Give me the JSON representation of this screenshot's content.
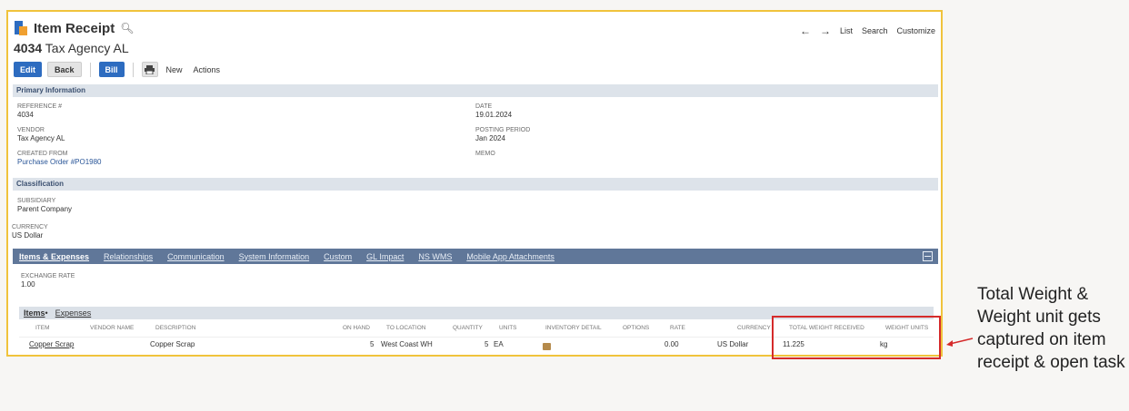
{
  "header": {
    "record_type": "Item Receipt",
    "record_number": "4034",
    "record_name": "Tax Agency AL",
    "nav": {
      "prev": "←",
      "next": "→",
      "list": "List",
      "search": "Search",
      "customize": "Customize"
    }
  },
  "buttons": {
    "edit": "Edit",
    "back": "Back",
    "bill": "Bill",
    "new": "New",
    "actions": "Actions"
  },
  "primary": {
    "title": "Primary Information",
    "reference_label": "REFERENCE #",
    "reference_value": "4034",
    "vendor_label": "VENDOR",
    "vendor_value": "Tax Agency AL",
    "created_from_label": "CREATED FROM",
    "created_from_value": "Purchase Order #PO1980",
    "date_label": "DATE",
    "date_value": "19.01.2024",
    "posting_period_label": "POSTING PERIOD",
    "posting_period_value": "Jan 2024",
    "memo_label": "MEMO"
  },
  "classification": {
    "title": "Classification",
    "subsidiary_label": "SUBSIDIARY",
    "subsidiary_value": "Parent Company",
    "currency_label": "CURRENCY",
    "currency_value": "US Dollar"
  },
  "tabs": [
    "Items & Expenses",
    "Relationships",
    "Communication",
    "System Information",
    "Custom",
    "GL Impact",
    "NS WMS",
    "Mobile App Attachments"
  ],
  "exchange": {
    "label": "EXCHANGE RATE",
    "value": "1.00"
  },
  "subtabs": {
    "items": "Items",
    "items_marker": "•",
    "expenses": "Expenses"
  },
  "columns": {
    "item": "ITEM",
    "vendor_name": "VENDOR NAME",
    "description": "DESCRIPTION",
    "on_hand": "ON HAND",
    "to_location": "TO LOCATION",
    "quantity": "QUANTITY",
    "units": "UNITS",
    "inventory_detail": "INVENTORY DETAIL",
    "options": "OPTIONS",
    "rate": "RATE",
    "currency": "CURRENCY",
    "total_weight": "TOTAL WEIGHT RECEIVED",
    "weight_units": "WEIGHT UNITS"
  },
  "row": {
    "item": "Copper Scrap",
    "description": "Copper Scrap",
    "on_hand": "5",
    "to_location": "West Coast WH",
    "quantity": "5",
    "units": "EA",
    "rate": "0.00",
    "currency": "US Dollar",
    "total_weight": "11.225",
    "weight_units": "kg"
  },
  "callout": {
    "text": "Total Weight & Weight unit gets captured on item receipt & open task"
  },
  "colors": {
    "tabbar": "#607799",
    "primary_button": "#2d6cc0",
    "highlight_box": "#d52b2b",
    "frame": "#f0c33c"
  }
}
